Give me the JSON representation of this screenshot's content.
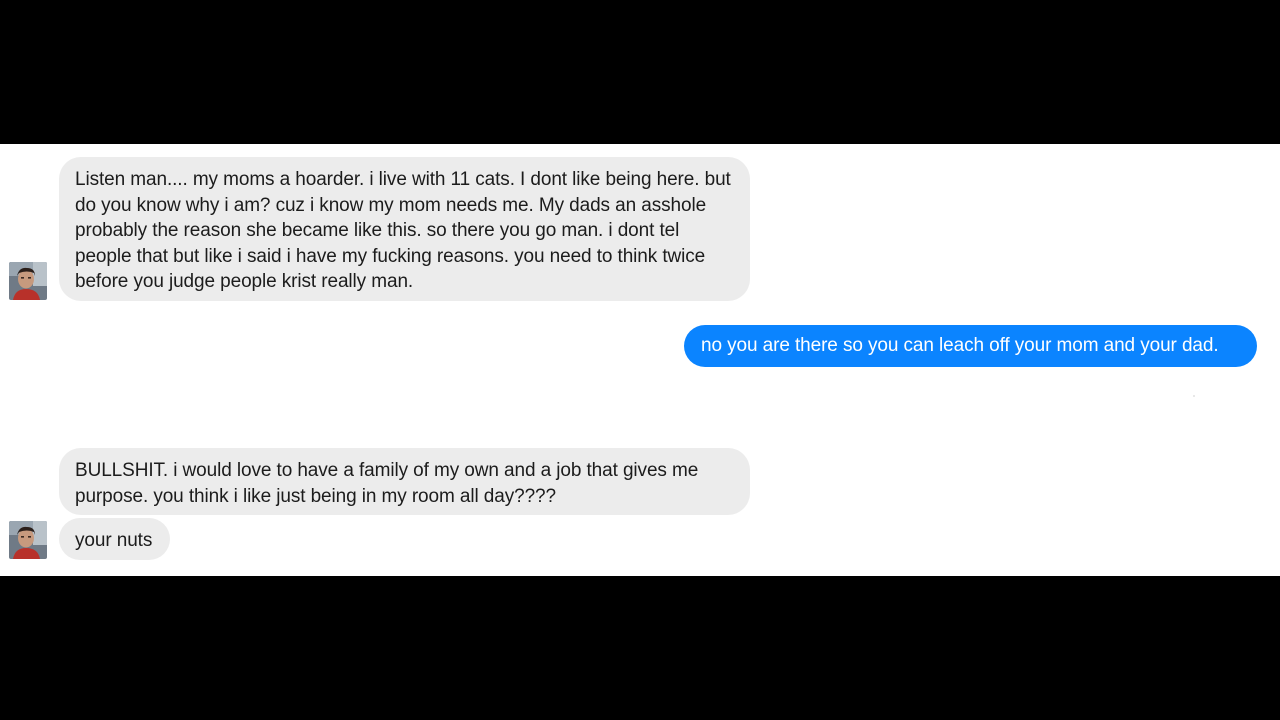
{
  "conversation": {
    "messages": [
      {
        "sender": "other",
        "text": "Listen man.... my moms a hoarder. i live with 11 cats. I dont like being here. but do you know why i am? cuz i know my mom needs me. My dads an asshole probably the reason she became like this. so there you go man. i dont tel people that but like i said i have my fucking reasons. you need to think twice before you judge people krist really man."
      },
      {
        "sender": "me",
        "text": "no you are there so you can leach off your  mom and your dad."
      },
      {
        "sender": "other",
        "text": "BULLSHIT. i would love to have a family of my own and a job that gives me purpose. you think i like just being in my room all day????"
      },
      {
        "sender": "other",
        "text": "your nuts"
      }
    ]
  },
  "colors": {
    "incoming_bubble": "#ececec",
    "outgoing_bubble": "#0b84ff",
    "outgoing_text": "#ffffff",
    "incoming_text": "#1c1c1c",
    "background": "#ffffff",
    "letterbox": "#000000"
  },
  "icons": {
    "avatar": "contact-avatar-icon"
  }
}
